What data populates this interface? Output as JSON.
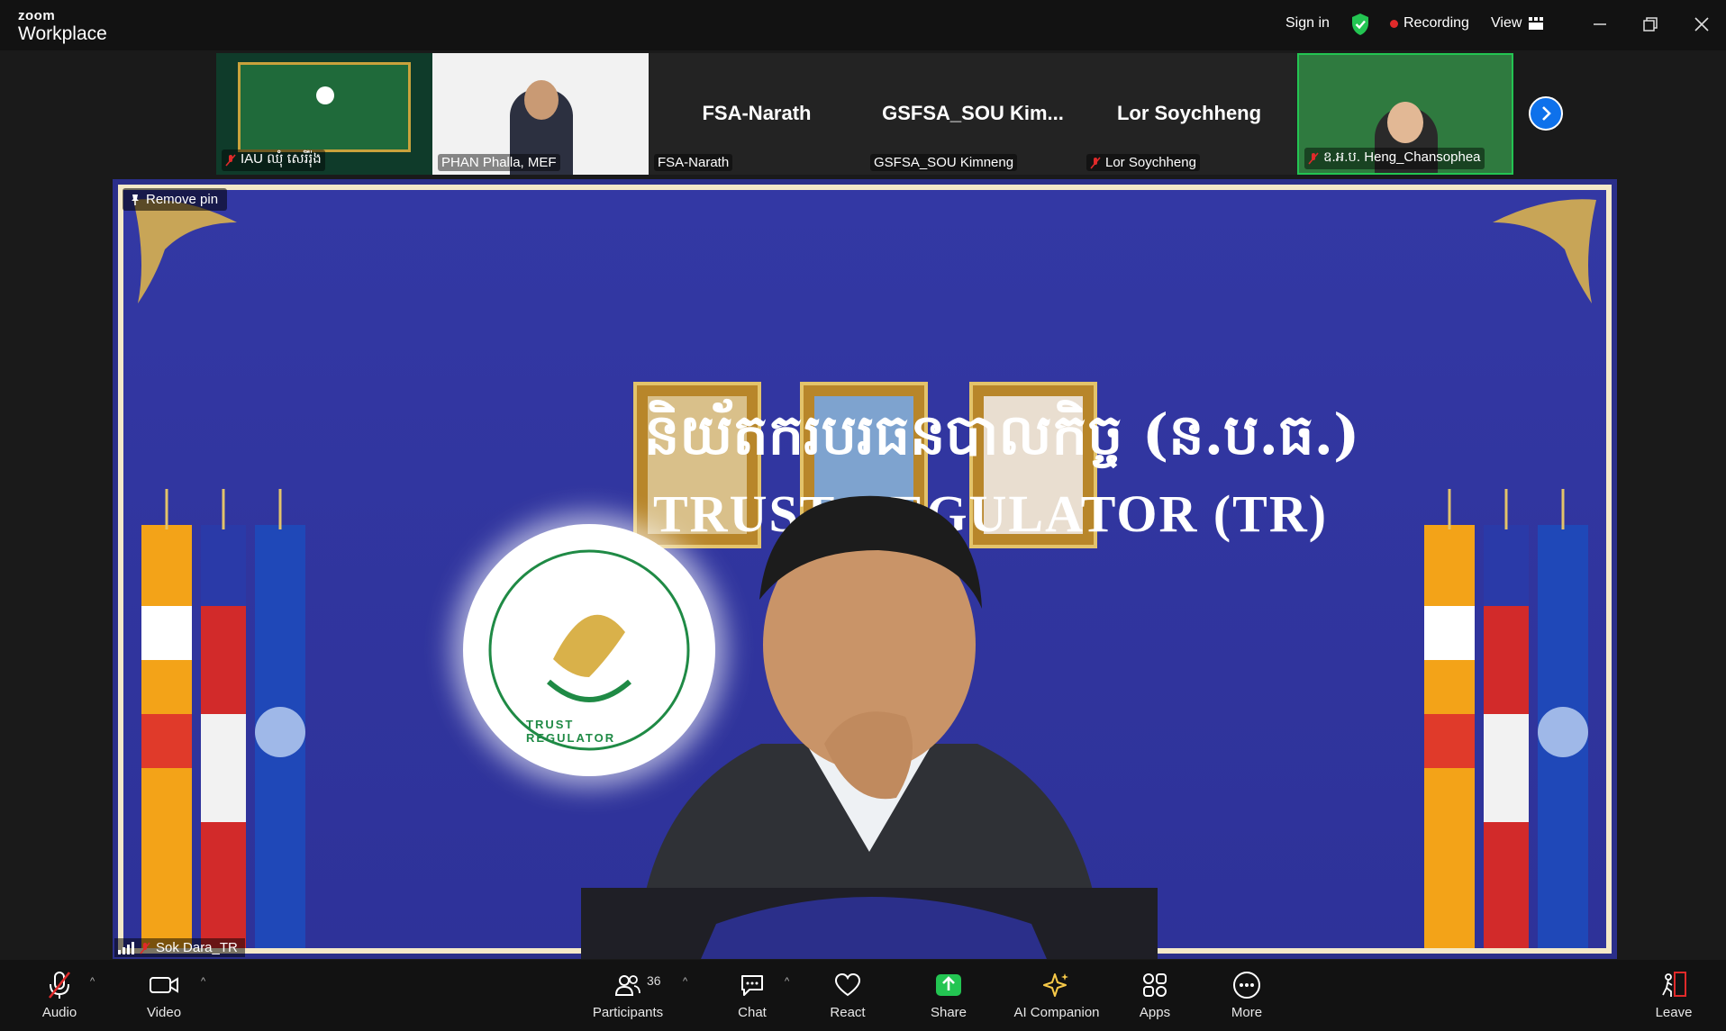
{
  "app": {
    "brand_top": "zoom",
    "brand_bottom": "Workplace"
  },
  "titlebar": {
    "sign_in": "Sign in",
    "recording": "Recording",
    "view": "View"
  },
  "filmstrip": {
    "tiles": [
      {
        "name": "IAU ឈុំ សេរីរ៉ុង",
        "muted": true,
        "kind": "video"
      },
      {
        "name": "PHAN Phalla, MEF",
        "muted": false,
        "kind": "video"
      },
      {
        "name": "FSA-Narath",
        "big_label": "FSA-Narath",
        "muted": false,
        "kind": "text"
      },
      {
        "name": "GSFSA_SOU Kimneng",
        "big_label": "GSFSA_SOU  Kim...",
        "muted": false,
        "kind": "text"
      },
      {
        "name": "Lor Soychheng",
        "big_label": "Lor Soychheng",
        "muted": true,
        "kind": "text"
      },
      {
        "name": "ឧ.អ.ប. Heng_Chansophea",
        "muted": true,
        "kind": "video"
      }
    ]
  },
  "main": {
    "pin_label": "Remove pin",
    "speaker": "Sok Dara_TR",
    "banner_khmer": "និយ័តករបរធនបាលកិច្ច (ន.ប.ធ.)",
    "banner_english": "TRUST REGULATOR (TR)",
    "seal_text": "TRUST REGULATOR"
  },
  "toolbar": {
    "audio": "Audio",
    "video": "Video",
    "participants": "Participants",
    "participants_count": "36",
    "chat": "Chat",
    "react": "React",
    "share": "Share",
    "ai_companion": "AI Companion",
    "apps": "Apps",
    "more": "More",
    "leave": "Leave"
  },
  "colors": {
    "accent": "#0e71eb",
    "share": "#23c552",
    "recording": "#e02a2a",
    "leave": "#e02a2a",
    "ai": "#f7c948",
    "banner": "#2e3299"
  }
}
